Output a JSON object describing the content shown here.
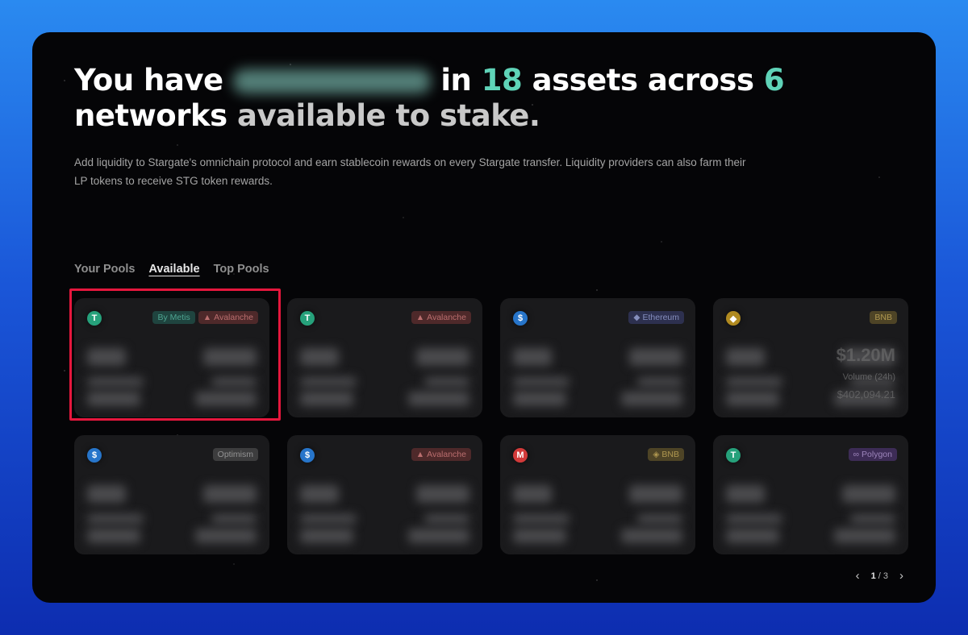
{
  "headline": {
    "line1_prefix": "You have",
    "line1_mid": "in",
    "asset_count": "18",
    "line1_suffix": "assets across",
    "network_count": "6",
    "line2_bold": "networks",
    "line2_dim": "available to stake."
  },
  "subtitle": "Add liquidity to Stargate's omnichain protocol and earn stablecoin rewards on every Stargate transfer. Liquidity providers can also farm their LP tokens to receive STG token rewards.",
  "tabs": [
    {
      "label": "Your Pools",
      "active": false
    },
    {
      "label": "Available",
      "active": true
    },
    {
      "label": "Top Pools",
      "active": false
    }
  ],
  "pools": [
    {
      "coin": "usdt-coin-icon",
      "coin_glyph": "T",
      "coin_color": "#26a17b",
      "badges": [
        {
          "label": "By Metis",
          "color": "#5fd3b8",
          "bg": "rgba(40,130,115,0.55)"
        },
        {
          "label": "Avalanche",
          "icon": "▲",
          "color": "#f08a8a",
          "bg": "rgba(180,70,70,0.45)"
        }
      ]
    },
    {
      "coin": "usdt-coin-icon",
      "coin_glyph": "T",
      "coin_color": "#26a17b",
      "badges": [
        {
          "label": "Avalanche",
          "icon": "▲",
          "color": "#f08a8a",
          "bg": "rgba(180,70,70,0.45)"
        }
      ]
    },
    {
      "coin": "usdc-coin-icon",
      "coin_glyph": "$",
      "coin_color": "#2775ca",
      "badges": [
        {
          "label": "Ethereum",
          "icon": "◆",
          "color": "#a9b5f3",
          "bg": "rgba(90,100,200,0.40)"
        }
      ]
    },
    {
      "coin": "bnb-coin-icon",
      "coin_glyph": "◆",
      "coin_color": "#b08a20",
      "badges": [
        {
          "label": "BNB",
          "color": "#e0c060",
          "bg": "rgba(180,150,60,0.45)"
        }
      ],
      "big_value": "$1.20M",
      "volume_label": "Volume (24h)",
      "volume_value": "$402,094.21"
    },
    {
      "coin": "usdc-coin-icon",
      "coin_glyph": "$",
      "coin_color": "#2775ca",
      "badges": [
        {
          "label": "Optimism",
          "color": "#bbbbbb",
          "bg": "rgba(160,160,160,0.35)"
        }
      ]
    },
    {
      "coin": "usdc-coin-icon",
      "coin_glyph": "$",
      "coin_color": "#2775ca",
      "badges": [
        {
          "label": "Avalanche",
          "icon": "▲",
          "color": "#f08a8a",
          "bg": "rgba(180,70,70,0.45)"
        }
      ]
    },
    {
      "coin": "mai-coin-icon",
      "coin_glyph": "M",
      "coin_color": "#d33a3a",
      "badges": [
        {
          "label": "BNB",
          "icon": "◈",
          "color": "#e0c060",
          "bg": "rgba(180,150,60,0.45)"
        }
      ]
    },
    {
      "coin": "usdt-coin-icon",
      "coin_glyph": "T",
      "coin_color": "#26a17b",
      "badges": [
        {
          "label": "Polygon",
          "icon": "∞",
          "color": "#c8a8f0",
          "bg": "rgba(130,80,200,0.45)"
        }
      ]
    }
  ],
  "pagination": {
    "current": "1",
    "separator": "/",
    "total": "3"
  }
}
